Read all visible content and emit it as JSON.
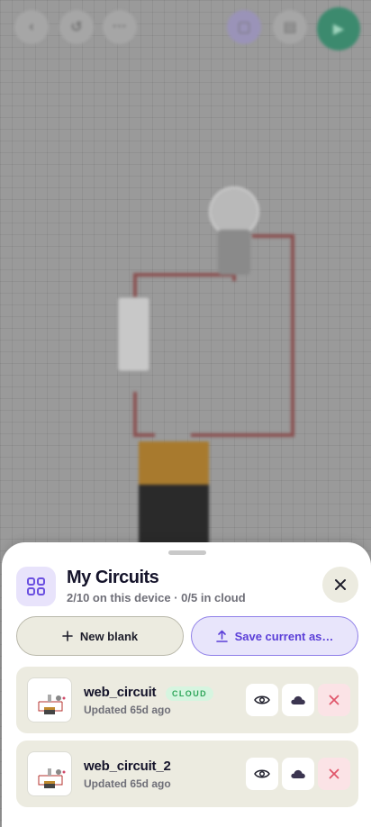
{
  "sheet": {
    "title": "My Circuits",
    "subtitle": "2/10 on this device · 0/5 in cloud",
    "new_blank_label": "New blank",
    "save_current_label": "Save current as…"
  },
  "circuits": [
    {
      "name": "web_circuit",
      "badge": "CLOUD",
      "meta": "Updated 65d ago"
    },
    {
      "name": "web_circuit_2",
      "badge": "",
      "meta": "Updated 65d ago"
    }
  ],
  "icons": {
    "header": "grid-icon",
    "close": "close-icon",
    "new": "plus-icon",
    "save": "upload-icon",
    "view": "eye-icon",
    "cloud": "cloud-icon",
    "delete": "close-icon"
  },
  "colors": {
    "accent": "#5b3fd8",
    "cloud_badge": "#2fa65a",
    "delete": "#e0566a",
    "wire": "#b5312c"
  }
}
